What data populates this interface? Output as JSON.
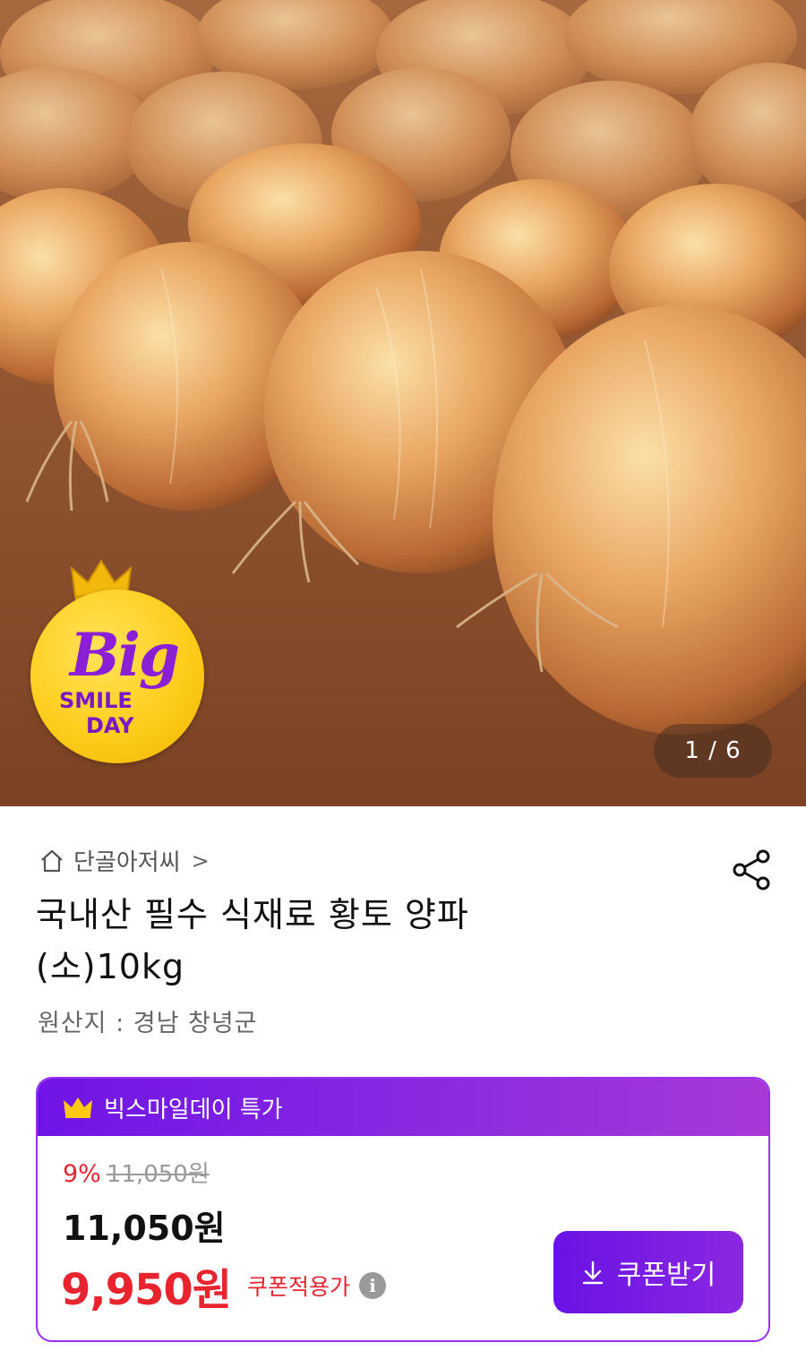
{
  "hero": {
    "counter": "1 / 6",
    "badge": {
      "big": "Big",
      "line1": "SMILE",
      "line2": "DAY"
    }
  },
  "store": {
    "name": "단골아저씨",
    "chevron": ">"
  },
  "product": {
    "title": "국내산 필수 식재료 황토 양파(소)10kg",
    "origin": "원산지 : 경남 창녕군"
  },
  "promo": {
    "header": "빅스마일데이 특가",
    "discount_rate": "9%",
    "original_price": "11,050원",
    "sale_price": "11,050원",
    "final_price": "9,950원",
    "coupon_applied_label": "쿠폰적용가",
    "coupon_button": "쿠폰받기"
  },
  "colors": {
    "accent_purple": "#7a1ee6",
    "price_red": "#e8242e",
    "badge_yellow": "#ffcd1c"
  }
}
